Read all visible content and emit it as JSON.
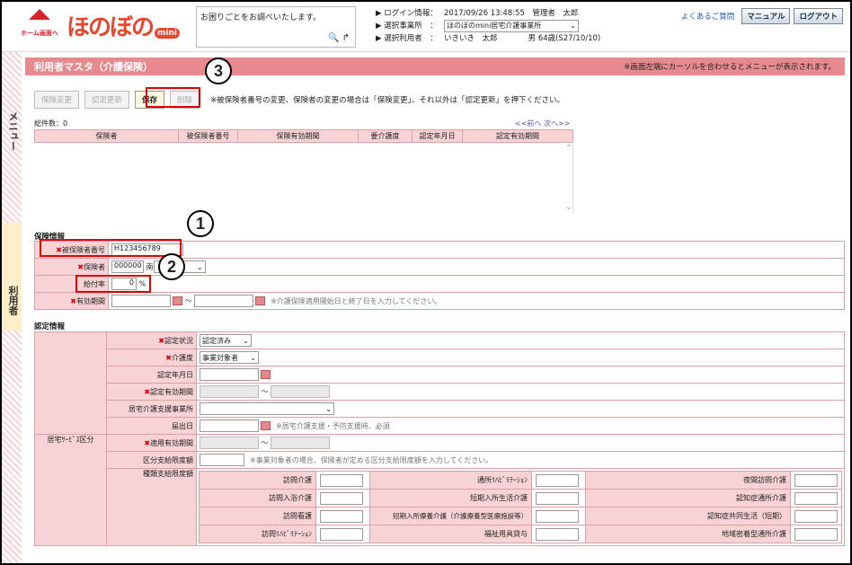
{
  "header": {
    "home_label": "ホーム画面へ",
    "logo_text": "ほのぼの",
    "logo_badge": "mini",
    "search_placeholder": "お困りごとをお調べいたします。",
    "login_key": "▶ ログイン情報：",
    "login_val": "2017/09/26 13:48:55　管理者　太郎",
    "office_key": "▶ 選択事業所　：",
    "office_val": "ほのぼのmini居宅介護事業所",
    "user_key": "▶ 選択利用者　：",
    "user_val": "いきいき　太郎　　　　男 64歳(S27/10/10)",
    "faq": "よくあるご質問",
    "manual": "マニュアル",
    "logout": "ログアウト"
  },
  "sidebar": {
    "menu": "メニュー",
    "user": "利用者"
  },
  "page": {
    "title": "利用者マスタ（介護保険）",
    "notice": "※画面左端にカーソルを合わせるとメニューが表示されます。"
  },
  "toolbar": {
    "change": "保険変更",
    "update": "認定更新",
    "save": "保存",
    "delete": "削除",
    "note": "※被保険者番号の変更、保険者の変更の場合は「保険変更」、それ以外は「認定更新」を押下ください。"
  },
  "list": {
    "total": "総件数：0",
    "pager": "<<前へ 次へ>>",
    "headers": [
      "保険者",
      "被保険者番号",
      "保険有効期間",
      "要介護度",
      "認定年月日",
      "認定有効期間"
    ]
  },
  "insurance": {
    "section": "保険情報",
    "insured_no_label": "被保険者番号",
    "insured_no": "H123456789",
    "insurer_label": "保険者",
    "insurer_code": "000000",
    "insurer_name": "南",
    "rate_label": "給付率",
    "rate": "0",
    "rate_unit": "%",
    "period_label": "有効期間",
    "period_sep": "～",
    "period_hint": "※介護保険適用開始日と終了日を入力してください。"
  },
  "cert": {
    "section": "認定情報",
    "status_label": "認定状況",
    "status": "認定済み",
    "level_label": "介護度",
    "level": "事業対象者",
    "date_label": "認定年月日",
    "period_label": "認定有効期間",
    "period_sep": "～",
    "office_label": "居宅介護支援事業所",
    "report_label": "届出日",
    "report_hint": "※居宅介護支援・予防支援時、必須",
    "svc_label": "居宅ｻｰﾋﾞｽ区分",
    "applied_label": "適用有効期間",
    "limit_label": "区分支給限度額",
    "limit_hint": "※事業対象者の場合、保険者が定める区分支給限度額を入力してください。",
    "kinds_label": "種類支給限度額",
    "services": [
      [
        "訪問介護",
        "通所ﾘﾊﾋﾞﾘﾃｰｼｮﾝ",
        "夜間訪問介護"
      ],
      [
        "訪問入浴介護",
        "短期入所生活介護",
        "認知症通所介護"
      ],
      [
        "訪問看護",
        "短期入所療養介護（介護療養型医療施設等）",
        "認知症共同生活（短期）"
      ],
      [
        "訪問ﾘﾊﾋﾞﾘﾃｰｼｮﾝ",
        "福祉用具貸与",
        "地域密着型通所介護"
      ]
    ]
  },
  "callouts": [
    "1",
    "2",
    "3"
  ]
}
